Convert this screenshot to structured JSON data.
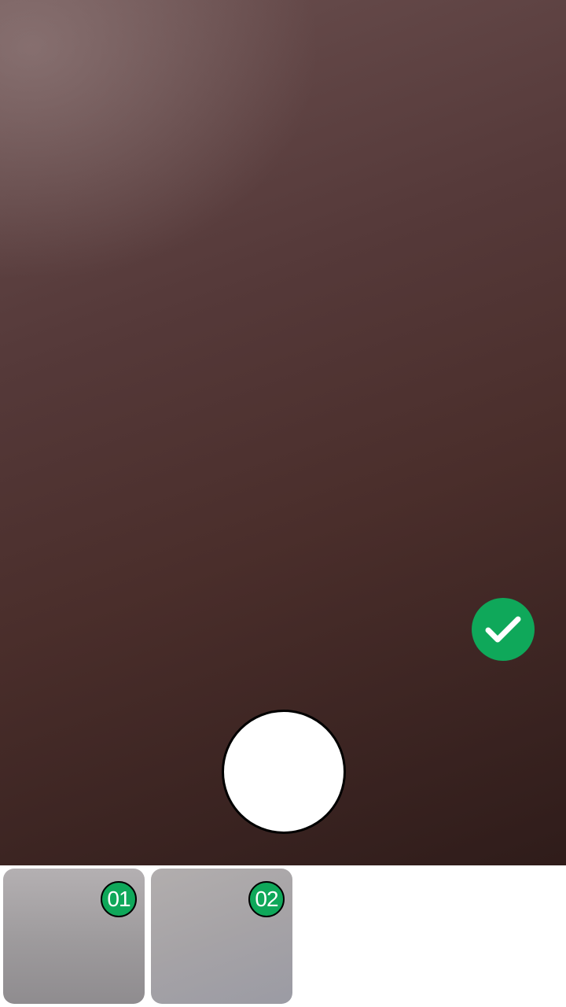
{
  "camera": {
    "viewfinder_description_color": "#4a2e2b",
    "confirm_button": {
      "icon": "checkmark-icon",
      "color": "#0fa85a"
    },
    "shutter_button": {
      "icon": "shutter-circle",
      "color": "#ffffff"
    }
  },
  "thumbnails": [
    {
      "index_label": "01",
      "badge_color": "#0fa85a"
    },
    {
      "index_label": "02",
      "badge_color": "#0fa85a"
    }
  ]
}
